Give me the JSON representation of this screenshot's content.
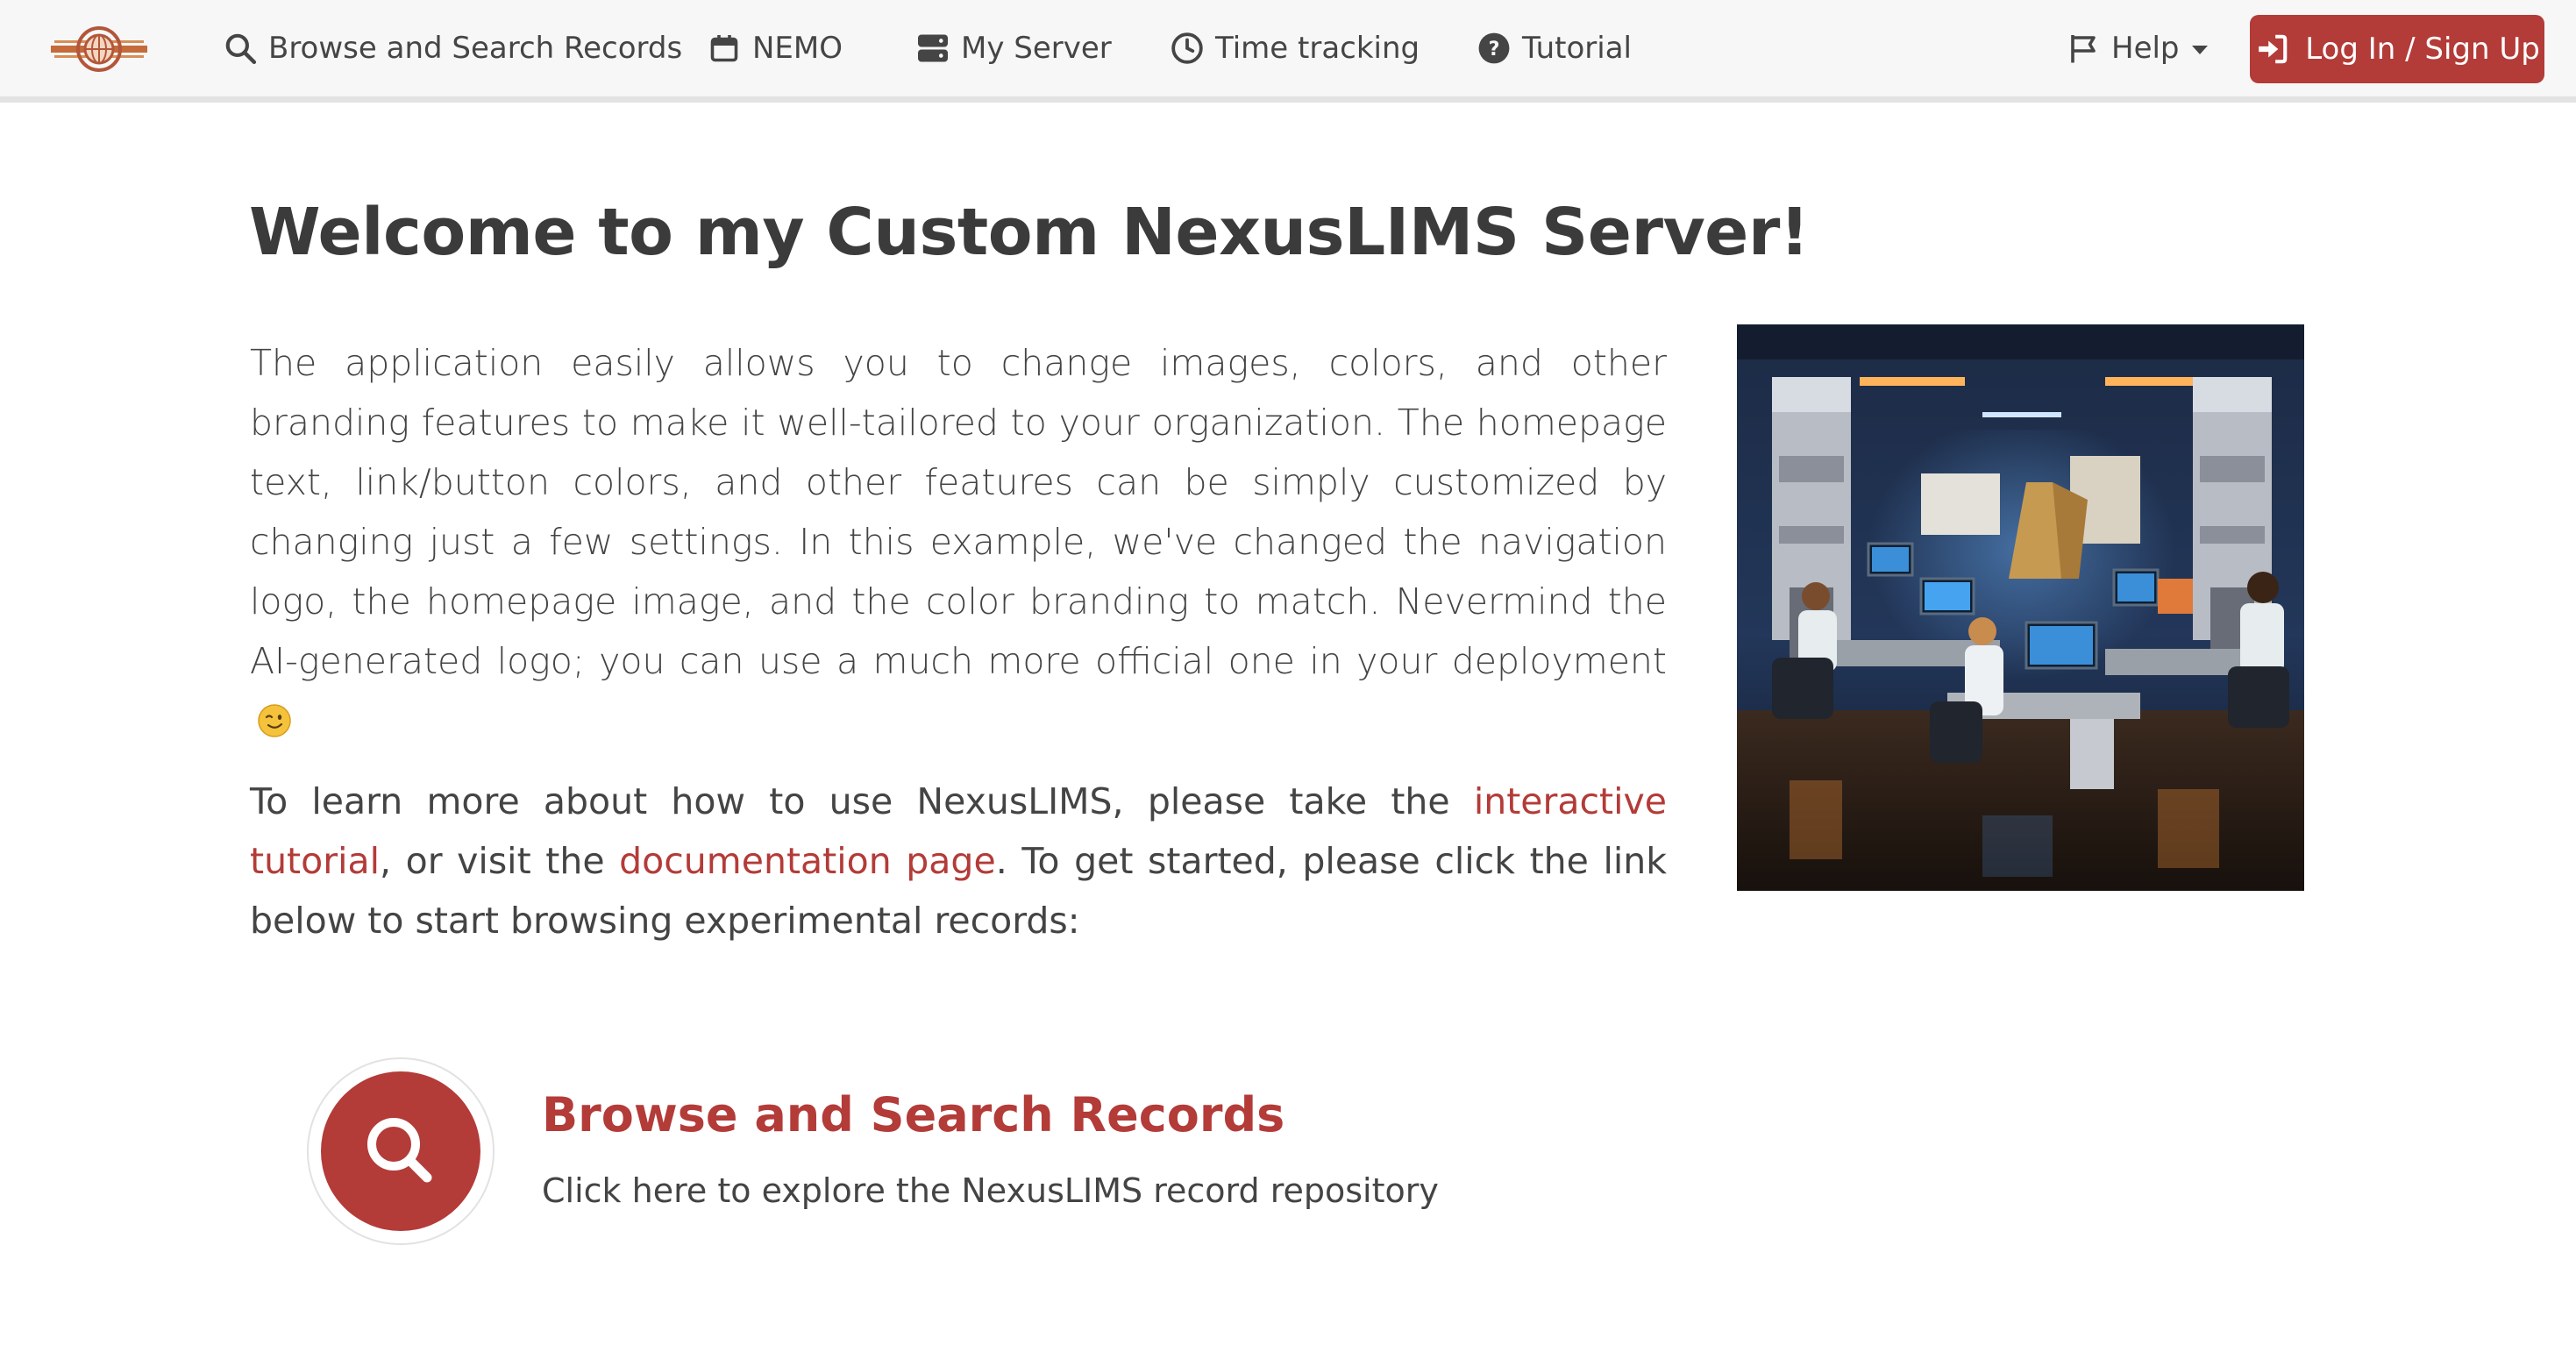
{
  "navbar": {
    "logo_alt": "NexusLIMS logo",
    "items": [
      {
        "label": "Browse and Search Records",
        "icon": "search-icon"
      },
      {
        "label": "NEMO",
        "icon": "calendar-icon"
      },
      {
        "label": "My Server",
        "icon": "server-icon"
      },
      {
        "label": "Time tracking",
        "icon": "clock-icon"
      },
      {
        "label": "Tutorial",
        "icon": "question-circle-icon"
      },
      {
        "label": "Help",
        "icon": "flag-icon"
      }
    ],
    "login_label": "Log In / Sign Up",
    "login_icon": "sign-in-icon"
  },
  "main": {
    "title": "Welcome to my Custom NexusLIMS Server!",
    "intro": "The application easily allows you to change images, colors, and other branding features to make it well-tailored to your organization. The homepage text, link/button colors, and other features can be simply customized by changing just a few settings. In this example, we've changed the navigation logo, the homepage image, and the color branding to match. Nevermind the AI-generated logo; you can use a much more official one in your deployment",
    "learn": {
      "part1": "To learn more about how to use NexusLIMS, please take the ",
      "link1": "interactive tutorial",
      "part2": ", or visit the ",
      "link2": "documentation page",
      "part3": ". To get started, please click the link below to start browsing experimental records:"
    },
    "hero_image_alt": "Illustration of scientists working at microscopes in a laboratory"
  },
  "feature": {
    "title": "Browse and Search Records",
    "description": "Click here to explore the NexusLIMS record repository",
    "icon": "search-icon"
  },
  "colors": {
    "accent": "#b33b38",
    "navbar_bg": "#f7f7f7",
    "text": "#444444"
  }
}
